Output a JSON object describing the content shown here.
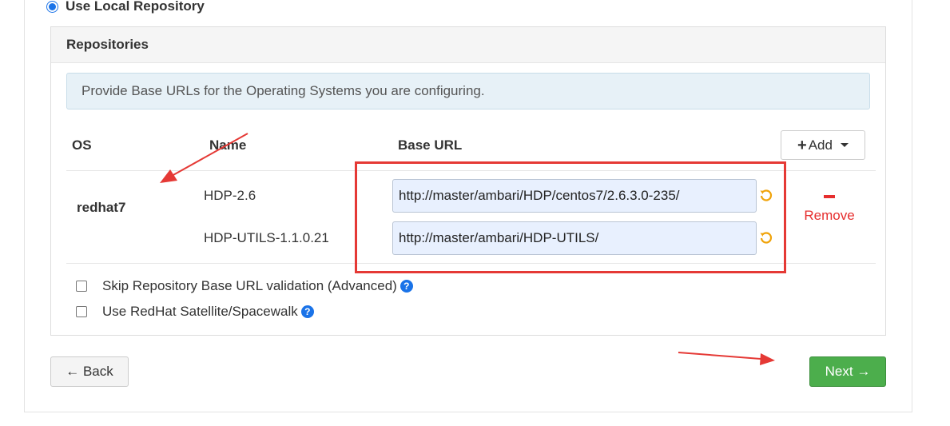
{
  "repository_option": {
    "label": "Use Local Repository",
    "selected": true
  },
  "panel": {
    "title": "Repositories",
    "info": "Provide Base URLs for the Operating Systems you are configuring."
  },
  "table": {
    "headers": {
      "os": "OS",
      "name": "Name",
      "base_url": "Base URL"
    },
    "add_button": "Add",
    "os": "redhat7",
    "repos": [
      {
        "name": "HDP-2.6",
        "base_url": "http://master/ambari/HDP/centos7/2.6.3.0-235/"
      },
      {
        "name": "HDP-UTILS-1.1.0.21",
        "base_url": "http://master/ambari/HDP-UTILS/"
      }
    ],
    "remove_label": "Remove"
  },
  "options": {
    "skip_validation": {
      "label": "Skip Repository Base URL validation (Advanced)",
      "checked": false
    },
    "satellite": {
      "label": "Use RedHat Satellite/Spacewalk",
      "checked": false
    }
  },
  "navigation": {
    "back": "← Back",
    "next": "Next →"
  },
  "colors": {
    "primary": "#1a73e8",
    "success": "#4cae4c",
    "danger": "#e62e2e",
    "annotation": "#e53935",
    "info_bg": "#e7f1f7",
    "input_bg": "#e8f0fe"
  },
  "icons": {
    "undo": "undo-icon",
    "help": "question-circle-icon",
    "add": "plus-icon",
    "remove": "minus-icon"
  }
}
